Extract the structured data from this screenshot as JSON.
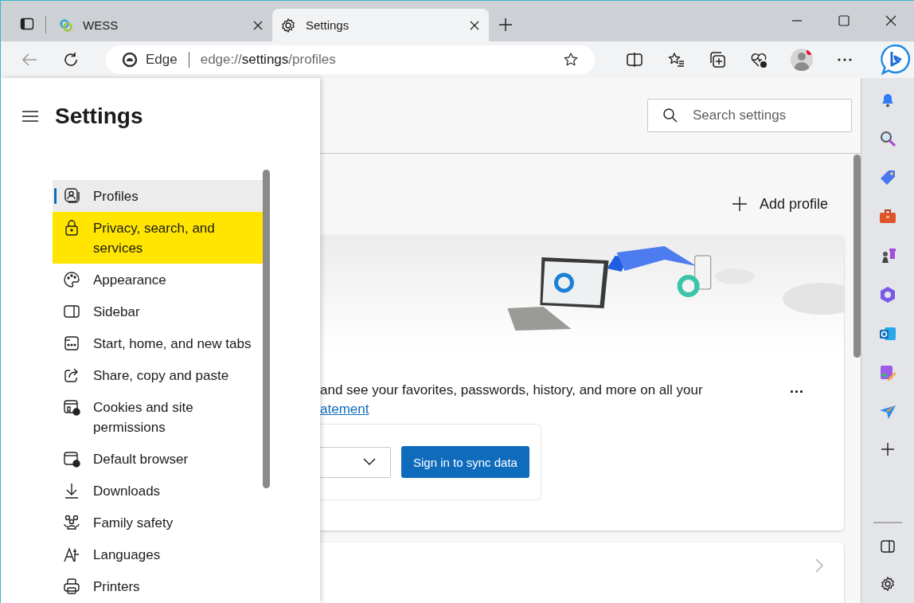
{
  "tabs": [
    {
      "title": "WESS",
      "selected": false
    },
    {
      "title": "Settings",
      "selected": true
    }
  ],
  "address": {
    "site_label": "Edge",
    "url_prefix": "edge://",
    "url_host": "settings",
    "url_path": "/profiles"
  },
  "settings_nav": {
    "title": "Settings",
    "items": [
      {
        "label": "Profiles",
        "selected": true,
        "highlighted": false
      },
      {
        "label": "Privacy, search, and services",
        "selected": false,
        "highlighted": true
      },
      {
        "label": "Appearance",
        "selected": false,
        "highlighted": false
      },
      {
        "label": "Sidebar",
        "selected": false,
        "highlighted": false
      },
      {
        "label": "Start, home, and new tabs",
        "selected": false,
        "highlighted": false
      },
      {
        "label": "Share, copy and paste",
        "selected": false,
        "highlighted": false
      },
      {
        "label": "Cookies and site permissions",
        "selected": false,
        "highlighted": false
      },
      {
        "label": "Default browser",
        "selected": false,
        "highlighted": false
      },
      {
        "label": "Downloads",
        "selected": false,
        "highlighted": false
      },
      {
        "label": "Family safety",
        "selected": false,
        "highlighted": false
      },
      {
        "label": "Languages",
        "selected": false,
        "highlighted": false
      },
      {
        "label": "Printers",
        "selected": false,
        "highlighted": false
      }
    ]
  },
  "search": {
    "placeholder": "Search settings"
  },
  "profiles": {
    "add_button": "Add profile",
    "description": "and see your favorites, passwords, history, and more on all your",
    "link": "atement",
    "more_button": "...",
    "sync_button": "Sign in to sync data"
  }
}
